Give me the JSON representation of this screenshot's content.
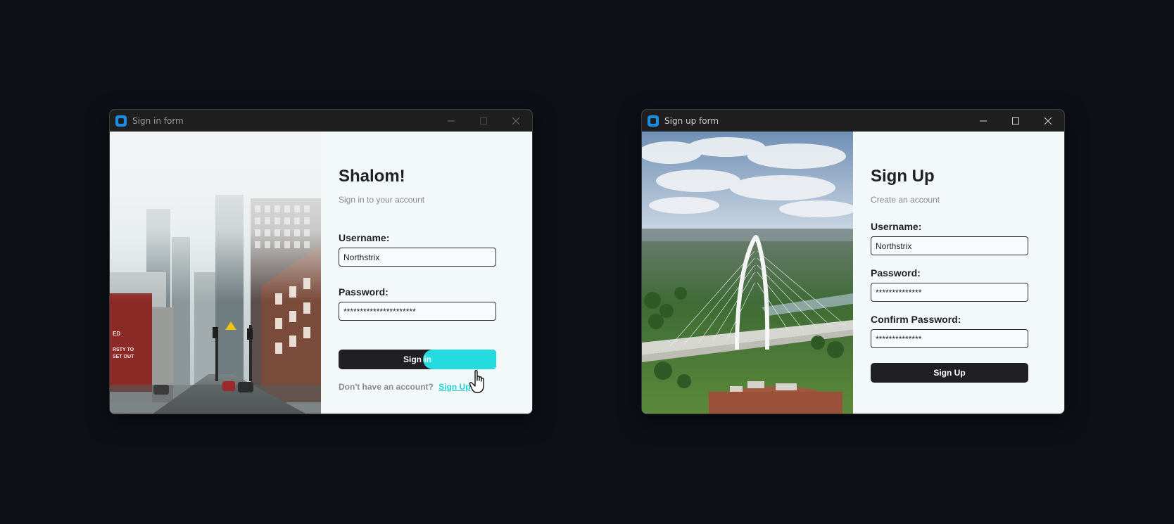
{
  "signin_window": {
    "title": "Sign in form",
    "heading": "Shalom!",
    "subheading": "Sign in to your account",
    "username_label": "Username:",
    "username_value": "Northstrix",
    "password_label": "Password:",
    "password_value": "**********************",
    "button_label": "Sign in",
    "footer_text": "Don't have an account?",
    "footer_link": "Sign Up",
    "accent_color": "#24dbdf"
  },
  "signup_window": {
    "title": "Sign up form",
    "heading": "Sign Up",
    "subheading": "Create an account",
    "username_label": "Username:",
    "username_value": "Northstrix",
    "password_label": "Password:",
    "password_value": "**************",
    "confirm_label": "Confirm Password:",
    "confirm_value": "**************",
    "button_label": "Sign Up"
  },
  "icons": {
    "app": "app-icon",
    "minimize": "minimize-icon",
    "maximize": "maximize-icon",
    "close": "close-icon",
    "pointer": "hand-pointer-icon"
  }
}
